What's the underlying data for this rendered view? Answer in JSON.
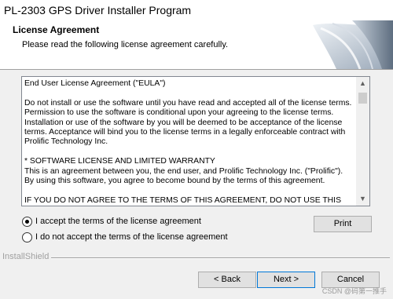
{
  "window": {
    "title": "PL-2303 GPS Driver Installer Program"
  },
  "header": {
    "title": "License Agreement",
    "subtitle": "Please read the following license agreement carefully."
  },
  "eula": {
    "paragraphs": [
      "End User License Agreement (\"EULA\")",
      "Do not install or use the software until you have read and accepted all of the license terms. Permission to use the software is conditional upon your agreeing to the license terms. Installation or use of the software by you will be deemed to be acceptance of the license terms. Acceptance will bind you to the license terms in a legally enforceable contract with Prolific Technology Inc.",
      "* SOFTWARE LICENSE AND LIMITED WARRANTY\nThis is an agreement between you, the end user, and Prolific Technology Inc. (\"Prolific\"). By using this software, you agree to become bound by the terms of this agreement.",
      "IF YOU DO NOT AGREE TO THE TERMS OF THIS AGREEMENT, DO NOT USE THIS"
    ]
  },
  "options": {
    "accept_label": "I accept the terms of the license agreement",
    "decline_label": "I do not accept the terms of the license agreement",
    "selected": "accept"
  },
  "buttons": {
    "print": "Print",
    "back": "< Back",
    "next": "Next >",
    "cancel": "Cancel"
  },
  "footer": {
    "brand": "InstallShield",
    "watermark": "CSDN @码第一推手"
  },
  "colors": {
    "accent": "#0078d7",
    "window_bg": "#f0f0f0"
  }
}
